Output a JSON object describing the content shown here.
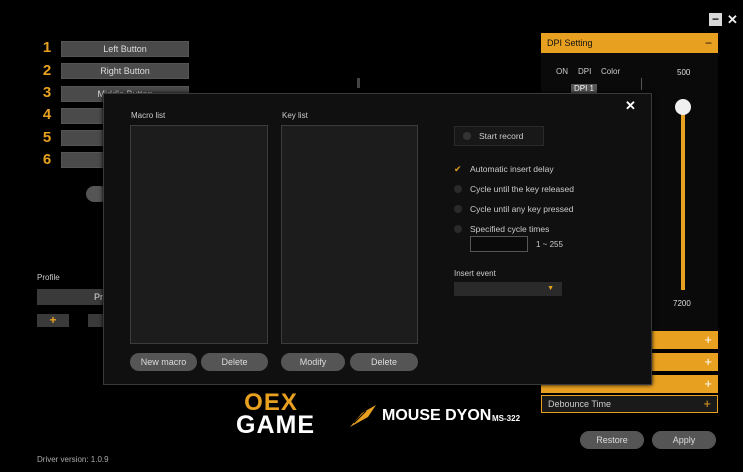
{
  "window": {
    "minimize_icon": "minimize-icon",
    "close_icon": "close-icon",
    "minimize_glyph": "−",
    "close_glyph": "✕"
  },
  "buttons": [
    {
      "num": "1",
      "label": "Left Button"
    },
    {
      "num": "2",
      "label": "Right Button"
    },
    {
      "num": "3",
      "label": "Middle Button"
    },
    {
      "num": "4",
      "label": ""
    },
    {
      "num": "5",
      "label": ""
    },
    {
      "num": "6",
      "label": ""
    }
  ],
  "profile": {
    "title": "Profile",
    "name": "Pr",
    "add": "+"
  },
  "dpi": {
    "header": "DPI Setting",
    "collapse": "−",
    "col_on": "ON",
    "col_dpi": "DPI",
    "col_color": "Color",
    "row1": "DPI 1",
    "max_label": "500",
    "min_label": "7200",
    "slider_level": 0.96
  },
  "side_sections": [
    {
      "plus": "+"
    },
    {
      "plus": "+"
    },
    {
      "plus": "+"
    }
  ],
  "debounce": {
    "label": "Debounce Time",
    "plus": "+"
  },
  "footer": {
    "restore": "Restore",
    "apply": "Apply",
    "version": "Driver version: 1.0.9"
  },
  "brand": {
    "logo_top": "OEX",
    "logo_bottom": "GAME",
    "product": "MOUSE DYON",
    "model": "MS-322"
  },
  "macro_dialog": {
    "close": "✕",
    "macro_list_label": "Macro list",
    "key_list_label": "Key list",
    "start_record": "Start record",
    "options": [
      {
        "label": "Automatic insert delay",
        "checked": true
      },
      {
        "label": "Cycle until the key released",
        "checked": false
      },
      {
        "label": "Cycle until any key pressed",
        "checked": false
      },
      {
        "label": "Specified cycle times",
        "checked": false
      }
    ],
    "cycle_range": "1 ~ 255",
    "insert_event_label": "Insert event",
    "insert_event_value": "",
    "new_macro": "New macro",
    "delete_macro": "Delete",
    "modify": "Modify",
    "delete_key": "Delete"
  },
  "colors": {
    "accent": "#e8a020",
    "background": "#000000",
    "button": "#4a4a4a"
  }
}
